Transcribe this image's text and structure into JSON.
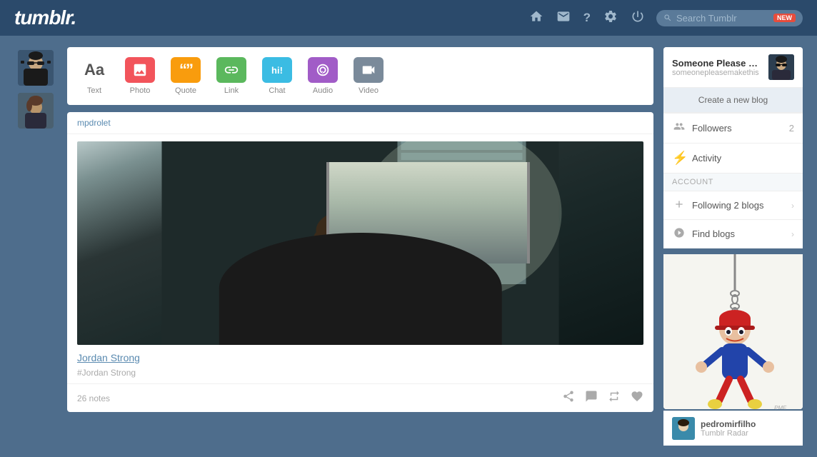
{
  "header": {
    "logo": "tumblr.",
    "nav": {
      "home_icon": "🏠",
      "mail_icon": "✉",
      "help_icon": "?",
      "settings_icon": "⚙",
      "power_icon": "⏻"
    },
    "search": {
      "placeholder": "Search Tumblr",
      "new_badge": "new"
    }
  },
  "left_sidebar": {
    "avatars": [
      {
        "id": "avatar-1",
        "label": "User avatar 1"
      },
      {
        "id": "avatar-2",
        "label": "User avatar 2"
      }
    ]
  },
  "composer": {
    "buttons": [
      {
        "id": "text",
        "label": "Text",
        "icon": "Aa"
      },
      {
        "id": "photo",
        "label": "Photo",
        "icon": "📷"
      },
      {
        "id": "quote",
        "label": "Quote",
        "icon": "❝❞"
      },
      {
        "id": "link",
        "label": "Link",
        "icon": "🔗"
      },
      {
        "id": "chat",
        "label": "Chat",
        "icon": "hi!"
      },
      {
        "id": "audio",
        "label": "Audio",
        "icon": "🎧"
      },
      {
        "id": "video",
        "label": "Video",
        "icon": "🎥"
      }
    ]
  },
  "posts": [
    {
      "username": "mpdrolet",
      "title": "Jordan Strong",
      "tag": "#Jordan Strong",
      "notes": "26 notes",
      "has_image": true
    }
  ],
  "right_sidebar": {
    "blog": {
      "name": "Someone Please M...",
      "url": "someonepleasemakethis",
      "create_blog_label": "Create a new blog"
    },
    "stats": {
      "followers_label": "Followers",
      "followers_count": "2",
      "activity_label": "Activity",
      "activity_icon": "⚡"
    },
    "account": {
      "section_label": "ACCOUNT",
      "following_label": "Following 2 blogs",
      "find_label": "Find blogs"
    },
    "radar": {
      "username": "pedromirfilho",
      "tag": "Tumblr Radar"
    }
  }
}
